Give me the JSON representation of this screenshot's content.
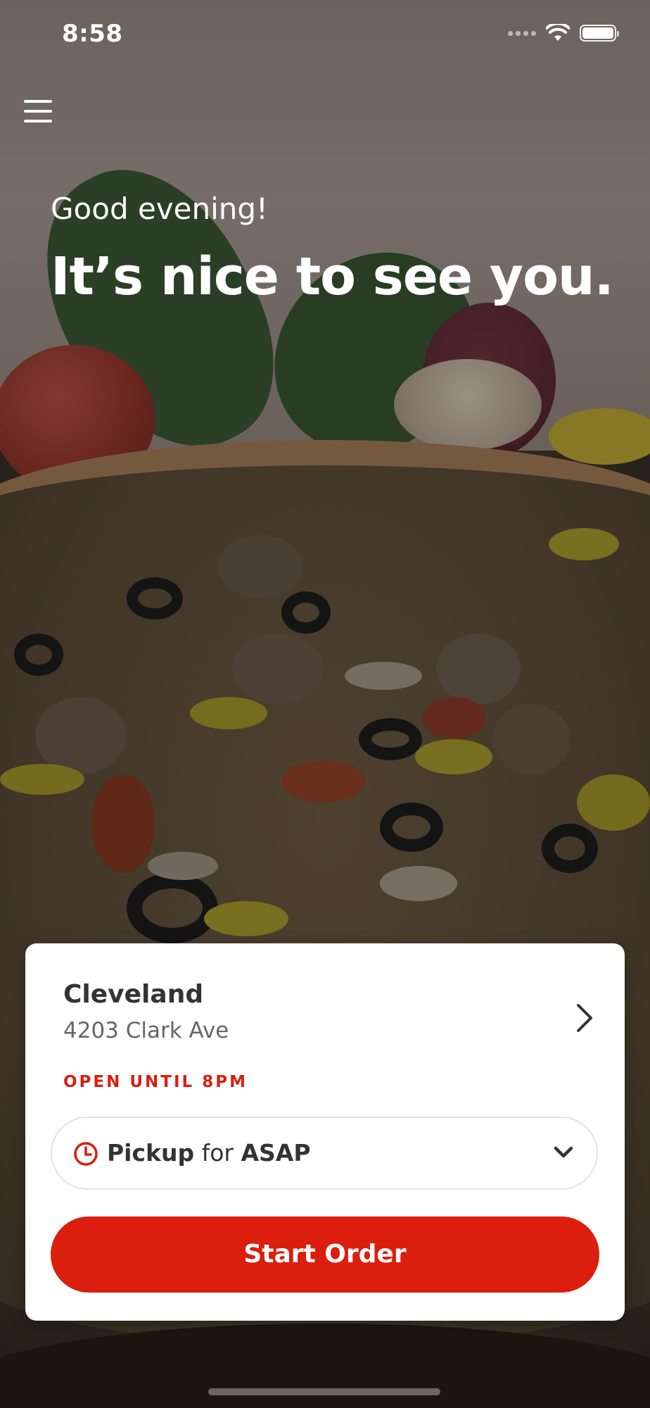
{
  "status_bar": {
    "time": "8:58"
  },
  "hero": {
    "greeting": "Good evening!",
    "headline": "It’s nice to see you."
  },
  "store_card": {
    "store_name": "Cleveland",
    "address": "4203 Clark Ave",
    "open_status": "OPEN UNTIL 8PM",
    "order_mode": {
      "method": "Pickup",
      "connector": "for",
      "time": "ASAP"
    },
    "start_order_label": "Start Order"
  },
  "colors": {
    "brand_red": "#db1e0d",
    "status_red": "#d91e10",
    "card_background": "#ffffff",
    "text_dark": "#333333",
    "text_muted": "#666666"
  },
  "icons": {
    "menu": "hamburger-menu-icon",
    "store_chevron": "chevron-right-icon",
    "clock": "clock-icon",
    "dropdown": "chevron-down-icon"
  }
}
